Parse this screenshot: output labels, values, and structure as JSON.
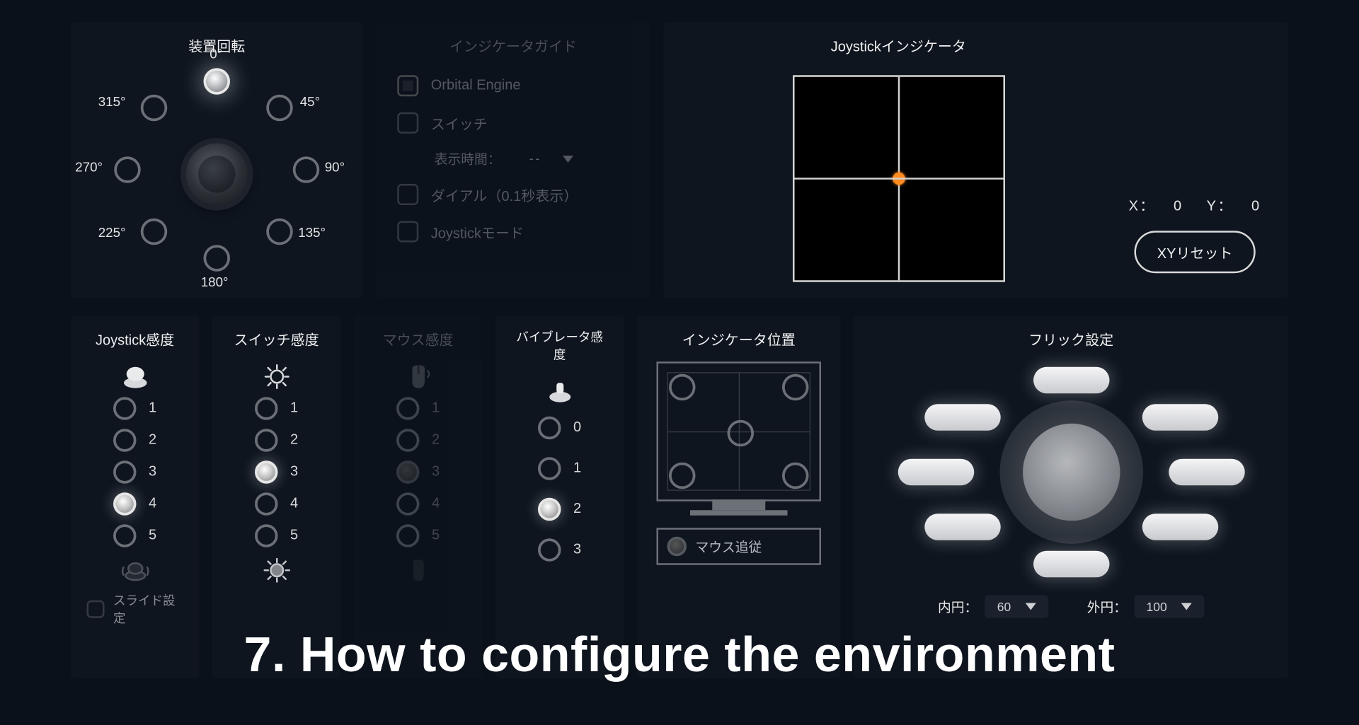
{
  "rotate": {
    "title": "装置回転",
    "labels": {
      "n": "0°",
      "ne": "45°",
      "e": "90°",
      "se": "135°",
      "s": "180°",
      "sw": "225°",
      "w": "270°",
      "nw": "315°"
    },
    "selected": "n"
  },
  "guide": {
    "title": "インジケータガイド",
    "items": {
      "orbital": "Orbital Engine",
      "switch": "スイッチ",
      "display_time_label": "表示時間：",
      "display_time_value": "--",
      "dial": "ダイアル（0.1秒表示）",
      "joystick_mode": "Joystickモード"
    }
  },
  "joystick": {
    "title": "Joystickインジケータ",
    "x_label": "X：",
    "x_value": "0",
    "y_label": "Y：",
    "y_value": "0",
    "reset": "XYリセット"
  },
  "sens_joystick": {
    "title": "Joystick感度",
    "opts": [
      "1",
      "2",
      "3",
      "4",
      "5"
    ],
    "selected": 3,
    "slide_label": "スライド設定"
  },
  "sens_switch": {
    "title": "スイッチ感度",
    "opts": [
      "1",
      "2",
      "3",
      "4",
      "5"
    ],
    "selected": 2
  },
  "sens_mouse": {
    "title": "マウス感度",
    "opts": [
      "1",
      "2",
      "3",
      "4",
      "5"
    ],
    "selected": 2
  },
  "sens_vib": {
    "title": "バイブレータ感度",
    "opts": [
      "0",
      "1",
      "2",
      "3"
    ],
    "selected": 2
  },
  "pos": {
    "title": "インジケータ位置",
    "mouse_follow": "マウス追従"
  },
  "flick": {
    "title": "フリック設定",
    "inner_label": "内円：",
    "inner_value": "60",
    "outer_label": "外円：",
    "outer_value": "100"
  },
  "overlay": "7. How to configure the environment"
}
